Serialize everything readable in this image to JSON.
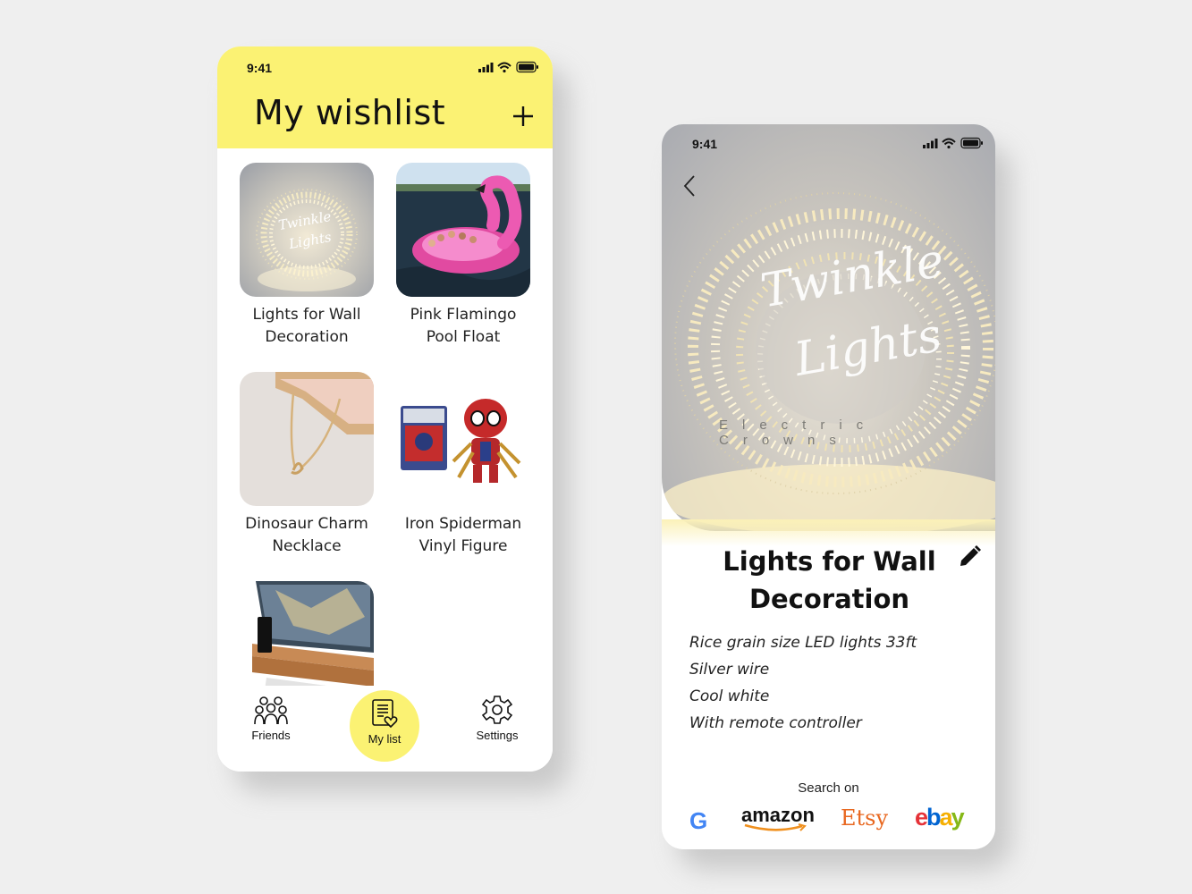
{
  "wishlist_screen": {
    "status_time": "9:41",
    "title": "My wishlist",
    "items": [
      {
        "label_line1": "Lights for Wall",
        "label_line2": "Decoration",
        "image_text_1": "Twinkle",
        "image_text_2": "Lights"
      },
      {
        "label_line1": "Pink Flamingo",
        "label_line2": "Pool Float"
      },
      {
        "label_line1": "Dinosaur Charm",
        "label_line2": "Necklace"
      },
      {
        "label_line1": "Iron Spiderman",
        "label_line2": "Vinyl Figure"
      },
      {
        "label_line1": "",
        "label_line2": ""
      }
    ],
    "nav": [
      {
        "label": "Friends",
        "icon": "friends-icon"
      },
      {
        "label": "My list",
        "icon": "list-heart-icon",
        "active": true
      },
      {
        "label": "Settings",
        "icon": "gear-icon"
      }
    ],
    "colors": {
      "accent": "#fbf273"
    }
  },
  "detail_screen": {
    "status_time": "9:41",
    "hero_text_1": "Twinkle",
    "hero_text_2": "Lights",
    "hero_brand": "Electric Crowns",
    "title_line1": "Lights for Wall",
    "title_line2": "Decoration",
    "specs": [
      "Rice grain size LED lights 33ft",
      "Silver wire",
      "Cool white",
      "With remote controller"
    ],
    "search_label": "Search on",
    "stores": {
      "google": "G",
      "amazon": "amazon",
      "etsy": "Etsy",
      "ebay_e": "e",
      "ebay_b": "b",
      "ebay_a": "a",
      "ebay_y": "y"
    }
  }
}
